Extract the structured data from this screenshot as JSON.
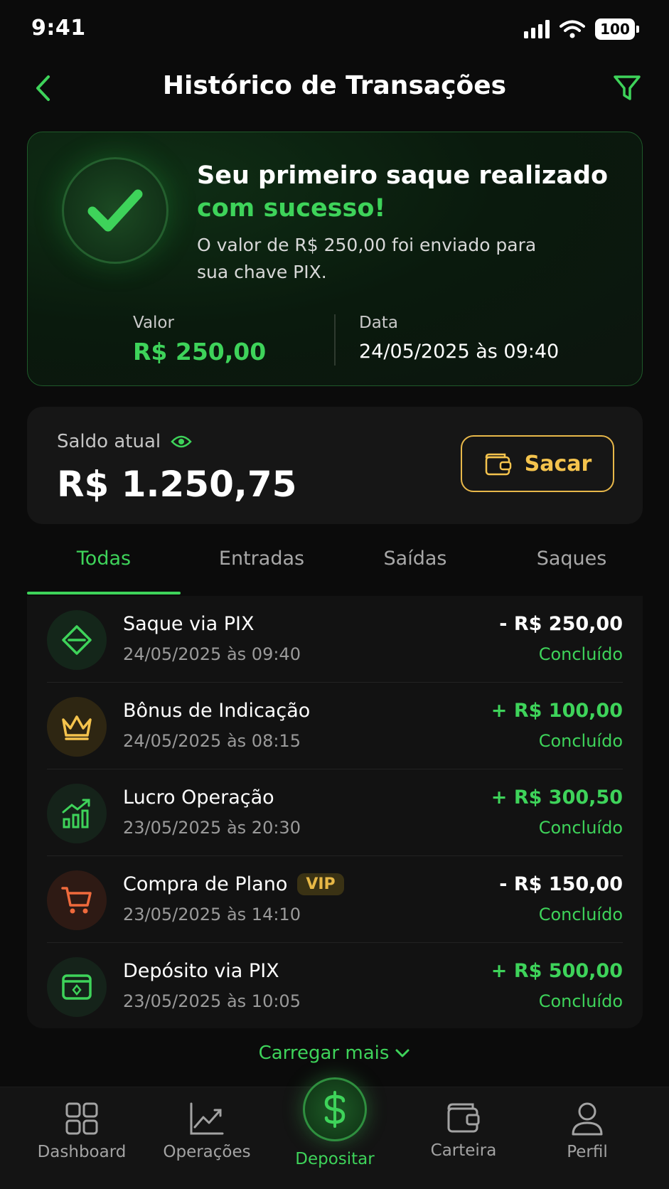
{
  "status_bar": {
    "time": "9:41",
    "battery": "100"
  },
  "header": {
    "title": "Histórico de Transações"
  },
  "success": {
    "title_line1": "Seu primeiro saque realizado",
    "title_line2": "com sucesso!",
    "message": "O valor de R$ 250,00 foi enviado para sua chave PIX.",
    "value_label": "Valor",
    "value": "R$ 250,00",
    "date_label": "Data",
    "date": "24/05/2025 às 09:40"
  },
  "balance": {
    "label": "Saldo atual",
    "amount": "R$ 1.250,75",
    "withdraw_label": "Sacar"
  },
  "tabs": [
    {
      "label": "Todas"
    },
    {
      "label": "Entradas"
    },
    {
      "label": "Saídas"
    },
    {
      "label": "Saques"
    }
  ],
  "transactions": [
    {
      "title": "Saque via PIX",
      "date": "24/05/2025 às 09:40",
      "amount": "- R$ 250,00",
      "status": "Concluído",
      "badge": ""
    },
    {
      "title": "Bônus de Indicação",
      "date": "24/05/2025 às 08:15",
      "amount": "+ R$ 100,00",
      "status": "Concluído",
      "badge": ""
    },
    {
      "title": "Lucro Operação",
      "date": "23/05/2025 às 20:30",
      "amount": "+ R$ 300,50",
      "status": "Concluído",
      "badge": ""
    },
    {
      "title": "Compra de Plano",
      "date": "23/05/2025 às 14:10",
      "amount": "- R$ 150,00",
      "status": "Concluído",
      "badge": "VIP"
    },
    {
      "title": "Depósito via PIX",
      "date": "23/05/2025 às 10:05",
      "amount": "+ R$ 500,00",
      "status": "Concluído",
      "badge": ""
    }
  ],
  "load_more": "Carregar mais",
  "nav": [
    {
      "label": "Dashboard"
    },
    {
      "label": "Operações"
    },
    {
      "label": "Depositar"
    },
    {
      "label": "Carteira"
    },
    {
      "label": "Perfil"
    }
  ],
  "colors": {
    "accent": "#3ed35a",
    "gold": "#f4c34d",
    "background": "#0b0b0b"
  }
}
